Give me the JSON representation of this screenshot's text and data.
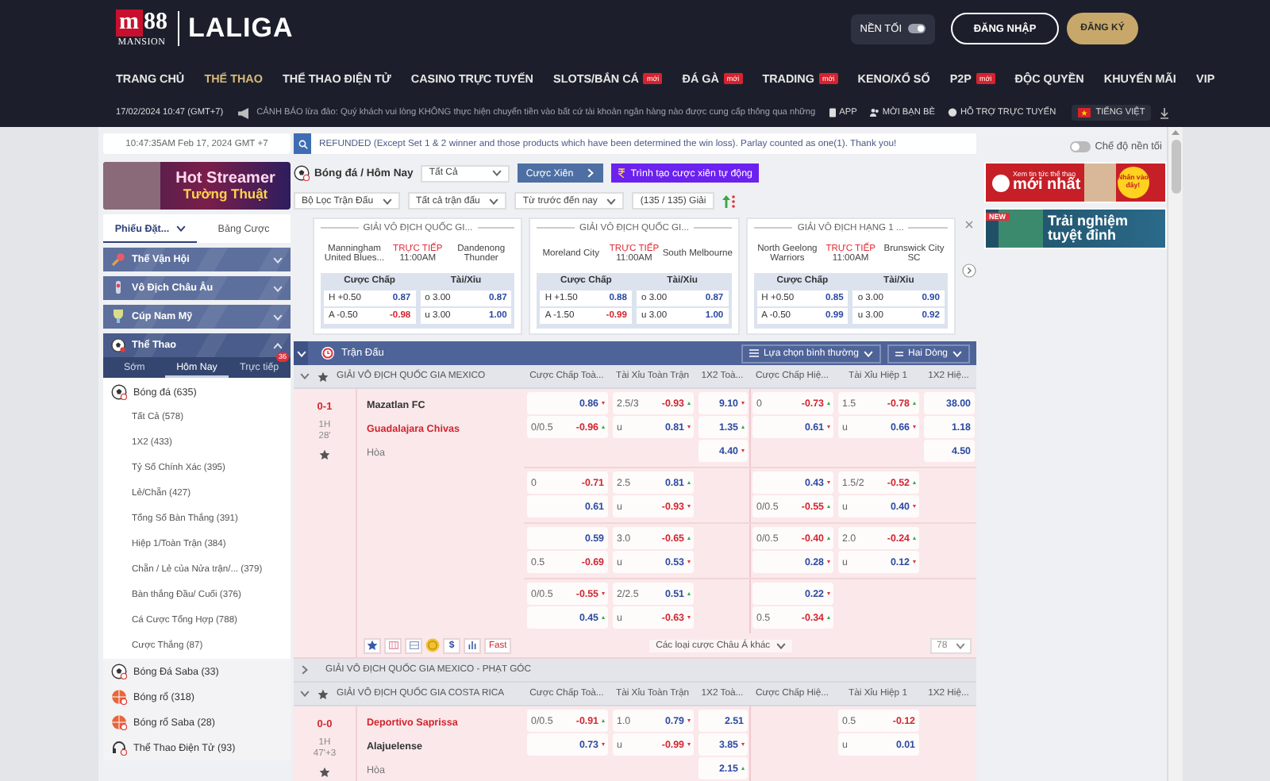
{
  "header": {
    "logo": {
      "mark": "m",
      "number": "88",
      "tagline": "MANSION"
    },
    "site_name": "LALIGA",
    "theme_toggle": {
      "label": "NỀN TỐI",
      "on": true
    },
    "buttons": [
      {
        "label": "ĐĂNG NHẬP",
        "kind": "outline"
      },
      {
        "label": "ĐĂNG KÝ",
        "kind": "primary"
      }
    ]
  },
  "nav": [
    {
      "label": "TRANG CHỦ",
      "selected": false
    },
    {
      "label": "THỂ THAO",
      "selected": true
    },
    {
      "label": "THỂ THAO ĐIỆN TỬ",
      "selected": false
    },
    {
      "label": "CASINO TRỰC TUYẾN",
      "selected": false
    },
    {
      "label": "SLOTS/BẮN CÁ",
      "selected": false,
      "badge": "mới"
    },
    {
      "label": "ĐÁ GÀ",
      "selected": false,
      "badge": "mới"
    },
    {
      "label": "TRADING",
      "selected": false,
      "badge": "mới"
    },
    {
      "label": "KENO/XỔ SỐ",
      "selected": false
    },
    {
      "label": "P2P",
      "selected": false,
      "badge": "mới"
    },
    {
      "label": "ĐỘC QUYỀN",
      "selected": false
    },
    {
      "label": "KHUYẾN MÃI",
      "selected": false
    },
    {
      "label": "VIP",
      "selected": false
    }
  ],
  "ticker": {
    "datetime": "17/02/2024 10:47 (GMT+7)",
    "message": "CẢNH BÁO lừa đảo: Quý khách vui lòng KHÔNG thực hiện chuyển tiền vào bất cứ tài khoản ngân hàng nào được cung cấp thông qua những",
    "links": [
      {
        "label": "APP",
        "kind": "app"
      },
      {
        "label": "MỜI BẠN BÈ",
        "kind": "invite"
      },
      {
        "label": "HỖ TRỢ TRỰC TUYẾN",
        "kind": "support"
      }
    ],
    "language": "TIẾNG VIỆT"
  },
  "sportsbook": {
    "clock": "10:47:35AM Feb 17, 2024 GMT +7",
    "announcement": "REFUNDED (Except Set 1 & 2 winner and those products which have been determined the win loss). Parlay counted as one(1). Thank you!",
    "dark_mode": {
      "label": "Chế độ nền tối",
      "on": false
    },
    "left": {
      "banner": {
        "title": "Hot Streamer",
        "subtitle": "Tường Thuật"
      },
      "bet_tabs": [
        {
          "label": "Phiếu Đặt...",
          "selected": true
        },
        {
          "label": "Bảng Cược",
          "selected": false
        }
      ],
      "categories": [
        {
          "label": "Thế Vận Hội",
          "kind": "olympics",
          "expanded": false
        },
        {
          "label": "Vô Địch Châu Âu",
          "kind": "euro",
          "expanded": false
        },
        {
          "label": "Cúp Nam Mỹ",
          "kind": "copa",
          "expanded": false
        },
        {
          "label": "Thể Thao",
          "kind": "sports",
          "expanded": true
        }
      ],
      "time_tabs": [
        {
          "label": "Sớm",
          "selected": false
        },
        {
          "label": "Hôm Nay",
          "selected": true
        },
        {
          "label": "Trực tiếp",
          "selected": false,
          "badge": "36"
        }
      ],
      "sports": [
        {
          "label": "Bóng đá",
          "count": "(635)",
          "kind": "soccer",
          "children": [
            {
              "label": "Tất Cả",
              "count": "(578)"
            },
            {
              "label": "1X2",
              "count": "(433)"
            },
            {
              "label": "Tỷ Số Chính Xác",
              "count": "(395)"
            },
            {
              "label": "Lẻ/Chẵn",
              "count": "(427)"
            },
            {
              "label": "Tổng Số Bàn Thắng",
              "count": "(391)"
            },
            {
              "label": "Hiệp 1/Toàn Trận",
              "count": "(384)"
            },
            {
              "label": "Chẵn / Lẻ của Nửa trận/...",
              "count": "(379)"
            },
            {
              "label": "Bàn thắng Đầu/ Cuối",
              "count": "(376)"
            },
            {
              "label": "Cá Cược Tổng Hợp",
              "count": "(788)"
            },
            {
              "label": "Cược Thắng",
              "count": "(87)"
            }
          ]
        },
        {
          "label": "Bóng Đá Saba",
          "count": "(33)",
          "kind": "soccer"
        },
        {
          "label": "Bóng rổ",
          "count": "(318)",
          "kind": "basketball"
        },
        {
          "label": "Bóng rổ Saba",
          "count": "(28)",
          "kind": "basketball"
        },
        {
          "label": "Thể Thao Điện Tử",
          "count": "(93)",
          "kind": "esports"
        }
      ]
    },
    "toolbar": {
      "breadcrumb": "Bóng đá / Hôm Nay",
      "market_select": "Tất Cả",
      "parlay_button": "Cược Xiên",
      "auto_parlay_button": "Trình tạo cược xiên tự động",
      "filters": [
        "Bộ Lọc Trận Đấu",
        "Tất cả trận đấu",
        "Từ trước đến nay"
      ],
      "league_count": "(135 / 135) Giải"
    },
    "featured": [
      {
        "league": "GIẢI VÔ ĐỊCH QUỐC GI...",
        "home": "Manningham United Blues...",
        "away": "Dandenong Thunder",
        "status": "TRỰC TIẾP",
        "time": "11:00AM",
        "handicap_label": "Cược Chấp",
        "total_label": "Tài/Xỉu",
        "rows": [
          {
            "handicap": "H +0.50",
            "handicap_odds": "0.87",
            "total": "o 3.00",
            "total_odds": "0.87"
          },
          {
            "handicap": "A -0.50",
            "handicap_odds": "-0.98",
            "total": "u 3.00",
            "total_odds": "1.00"
          }
        ]
      },
      {
        "league": "GIẢI VÔ ĐỊCH QUỐC GI...",
        "home": "Moreland City",
        "away": "South Melbourne",
        "status": "TRỰC TIẾP",
        "time": "11:00AM",
        "handicap_label": "Cược Chấp",
        "total_label": "Tài/Xỉu",
        "rows": [
          {
            "handicap": "H +1.50",
            "handicap_odds": "0.88",
            "total": "o 3.00",
            "total_odds": "0.87"
          },
          {
            "handicap": "A -1.50",
            "handicap_odds": "-0.99",
            "total": "u 3.00",
            "total_odds": "1.00"
          }
        ]
      },
      {
        "league": "GIẢI VÔ ĐỊCH HẠNG 1 ...",
        "home": "North Geelong Warriors",
        "away": "Brunswick City SC",
        "status": "TRỰC TIẾP",
        "time": "11:00AM",
        "handicap_label": "Cược Chấp",
        "total_label": "Tài/Xỉu",
        "rows": [
          {
            "handicap": "H +0.50",
            "handicap_odds": "0.85",
            "total": "o 3.00",
            "total_odds": "0.90"
          },
          {
            "handicap": "A -0.50",
            "handicap_odds": "0.99",
            "total": "u 3.00",
            "total_odds": "0.92"
          }
        ]
      }
    ],
    "table": {
      "title": "Trận Đấu",
      "view_select": "Lựa chọn bình thường",
      "lines_select": "Hai Dòng",
      "leagues": [
        {
          "name": "GIẢI VÔ ĐỊCH QUỐC GIA MEXICO",
          "expanded": true,
          "columns": [
            "Cược Chấp Toà...",
            "Tài Xỉu Toàn Trận",
            "1X2 Toà...",
            "Cược Chấp Hiệ...",
            "Tài Xỉu Hiệp 1",
            "1X2 Hiệ..."
          ],
          "matches": [
            {
              "score": "0-1",
              "period": "1H",
              "minute": "28'",
              "home": {
                "name": "Mazatlan FC",
                "favorite": false
              },
              "away": {
                "name": "Guadalajara Chivas",
                "favorite": true
              },
              "draw": "Hòa",
              "line_groups": [
                [
                  {
                    "handicap": {
                      "odds": "0.86",
                      "kind": "falling"
                    },
                    "over_under": {
                      "line": "2.5/3",
                      "odds": "-0.93",
                      "kind": "rising"
                    },
                    "result_1x2": {
                      "odds": "9.10",
                      "kind": "falling"
                    },
                    "half_handicap": {
                      "line": "0",
                      "odds": "-0.73",
                      "kind": "rising"
                    },
                    "half_over_under": {
                      "line": "1.5",
                      "odds": "-0.78",
                      "kind": "rising"
                    },
                    "half_result_1x2": {
                      "odds": "38.00"
                    }
                  },
                  {
                    "handicap": {
                      "line": "0/0.5",
                      "odds": "-0.96",
                      "kind": "rising"
                    },
                    "over_under": {
                      "line": "u",
                      "odds": "0.81",
                      "kind": "falling"
                    },
                    "result_1x2": {
                      "odds": "1.35",
                      "kind": "rising"
                    },
                    "half_handicap": {
                      "odds": "0.61",
                      "kind": "falling"
                    },
                    "half_over_under": {
                      "line": "u",
                      "odds": "0.66",
                      "kind": "falling"
                    },
                    "half_result_1x2": {
                      "odds": "1.18"
                    }
                  },
                  {
                    "result_1x2": {
                      "odds": "4.40",
                      "kind": "falling"
                    },
                    "half_result_1x2": {
                      "odds": "4.50"
                    }
                  }
                ],
                [
                  {
                    "handicap": {
                      "line": "0",
                      "odds": "-0.71"
                    },
                    "over_under": {
                      "line": "2.5",
                      "odds": "0.81",
                      "kind": "rising"
                    },
                    "half_handicap": {
                      "odds": "0.43",
                      "kind": "falling"
                    },
                    "half_over_under": {
                      "line": "1.5/2",
                      "odds": "-0.52",
                      "kind": "rising"
                    }
                  },
                  {
                    "handicap": {
                      "odds": "0.61"
                    },
                    "over_under": {
                      "line": "u",
                      "odds": "-0.93",
                      "kind": "falling"
                    },
                    "half_handicap": {
                      "line": "0/0.5",
                      "odds": "-0.55",
                      "kind": "rising"
                    },
                    "half_over_under": {
                      "line": "u",
                      "odds": "0.40",
                      "kind": "falling"
                    }
                  }
                ],
                [
                  {
                    "handicap": {
                      "odds": "0.59"
                    },
                    "over_under": {
                      "line": "3.0",
                      "odds": "-0.65",
                      "kind": "rising"
                    },
                    "half_handicap": {
                      "line": "0/0.5",
                      "odds": "-0.40",
                      "kind": "rising"
                    },
                    "half_over_under": {
                      "line": "2.0",
                      "odds": "-0.24",
                      "kind": "rising"
                    }
                  },
                  {
                    "handicap": {
                      "line": "0.5",
                      "odds": "-0.69"
                    },
                    "over_under": {
                      "line": "u",
                      "odds": "0.53",
                      "kind": "falling"
                    },
                    "half_handicap": {
                      "odds": "0.28",
                      "kind": "falling"
                    },
                    "half_over_under": {
                      "line": "u",
                      "odds": "0.12",
                      "kind": "falling"
                    }
                  }
                ],
                [
                  {
                    "handicap": {
                      "line": "0/0.5",
                      "odds": "-0.55",
                      "kind": "falling"
                    },
                    "over_under": {
                      "line": "2/2.5",
                      "odds": "0.51",
                      "kind": "rising"
                    },
                    "half_handicap": {
                      "odds": "0.22",
                      "kind": "falling"
                    }
                  },
                  {
                    "handicap": {
                      "odds": "0.45",
                      "kind": "rising"
                    },
                    "over_under": {
                      "line": "u",
                      "odds": "-0.63",
                      "kind": "falling"
                    },
                    "half_handicap": {
                      "line": "0.5",
                      "odds": "-0.34",
                      "kind": "rising"
                    }
                  }
                ]
              ],
              "footer": {
                "currency_symbol": "$",
                "fast_label": "Fast",
                "market_select": "Các loại cược Châu Á khác",
                "count": "78"
              }
            }
          ]
        },
        {
          "name": "GIẢI VÔ ĐỊCH QUỐC GIA MEXICO - PHẠT GÓC",
          "expanded": false
        },
        {
          "name": "GIẢI VÔ ĐỊCH QUỐC GIA COSTA RICA",
          "expanded": true,
          "columns": [
            "Cược Chấp Toà...",
            "Tài Xỉu Toàn Trận",
            "1X2 Toà...",
            "Cược Chấp Hiệ...",
            "Tài Xỉu Hiệp 1",
            "1X2 Hiệ..."
          ],
          "matches": [
            {
              "score": "0-0",
              "period": "1H",
              "minute": "47'+3",
              "home": {
                "name": "Deportivo Saprissa",
                "favorite": true
              },
              "away": {
                "name": "Alajuelense",
                "favorite": false
              },
              "draw": "Hòa",
              "line_groups": [
                [
                  {
                    "handicap": {
                      "line": "0/0.5",
                      "odds": "-0.91",
                      "kind": "rising"
                    },
                    "over_under": {
                      "line": "1.0",
                      "odds": "0.79",
                      "kind": "falling"
                    },
                    "result_1x2": {
                      "odds": "2.51"
                    },
                    "half_over_under": {
                      "line": "0.5",
                      "odds": "-0.12"
                    }
                  },
                  {
                    "handicap": {
                      "odds": "0.73",
                      "kind": "falling"
                    },
                    "over_under": {
                      "line": "u",
                      "odds": "-0.99",
                      "kind": "falling"
                    },
                    "result_1x2": {
                      "odds": "3.85",
                      "kind": "falling"
                    },
                    "half_over_under": {
                      "line": "u",
                      "odds": "0.01"
                    }
                  },
                  {
                    "result_1x2": {
                      "odds": "2.15",
                      "kind": "rising"
                    }
                  }
                ]
              ]
            }
          ]
        }
      ]
    },
    "right": {
      "banners": [
        {
          "kind": "news",
          "caption": "Xem tin tức thể thao",
          "headline": "mới nhất",
          "badge": "Nhấn vào đây!"
        },
        {
          "kind": "promo",
          "ribbon": "NEW",
          "headline": "Trải nghiệm tuyệt đỉnh"
        }
      ]
    }
  }
}
